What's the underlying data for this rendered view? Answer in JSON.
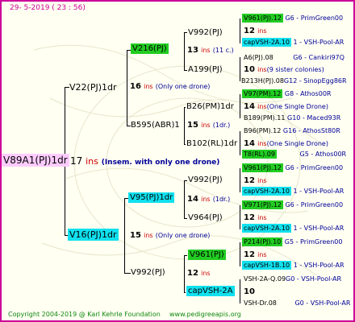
{
  "header": {
    "date": "29-  5-2019  ( 23 : 56)"
  },
  "root": {
    "name": "V89A1(PJ)1dr",
    "ins": "17",
    "ins_word": "ins",
    "note": "(Insem. with only one drone)"
  },
  "gen1": [
    {
      "name": "V22(PJ)1dr",
      "ins": "16",
      "ins_word": "ins",
      "note": "(Only one drone)"
    },
    {
      "name": "V16(PJ)1dr",
      "ins": "15",
      "ins_word": "ins",
      "note": "(Only one drone)"
    }
  ],
  "gen2": [
    {
      "name": "V216(PJ)",
      "ins": "13",
      "ins_word": "ins",
      "note": "(11 c.)"
    },
    {
      "name": "B595(ABR)1",
      "ins": "15",
      "ins_word": "ins",
      "note": "(1dr.)"
    },
    {
      "name": "V95(PJ)1dr",
      "ins": "14",
      "ins_word": "ins",
      "note": "(1dr.)"
    },
    {
      "name": "V992(PJ)",
      "ins": "12",
      "ins_word": "ins",
      "note": ""
    }
  ],
  "gen3": [
    {
      "name": "V992(PJ)"
    },
    {
      "name": "A199(PJ)"
    },
    {
      "name": "B26(PM)1dr"
    },
    {
      "name": "B102(RL)1dr"
    },
    {
      "name": "V992(PJ)"
    },
    {
      "name": "V964(PJ)"
    },
    {
      "name": "V961(PJ)"
    },
    {
      "name": "capVSH-2A"
    }
  ],
  "gen4": [
    {
      "top": "V961(PJ).12",
      "top_info": "G6 - PrimGreen00",
      "ins": "12",
      "ins_word": "ins",
      "note": "",
      "bottom": "capVSH-2A.10",
      "bottom_info": "1 - VSH-Pool-AR"
    },
    {
      "top": "A6(PJ).08",
      "top_info": "G6 - Cankiri97Q",
      "ins": "10",
      "ins_word": "ins",
      "note": "(9 sister colonies)",
      "bottom": "B213H(PJ).08",
      "bottom_info": "G12 - SinopEgg86R"
    },
    {
      "top": "V97(PM).12",
      "top_info": "G8 - Athos00R",
      "ins": "14",
      "ins_word": "ins",
      "note": "(One Single Drone)",
      "bottom": "B189(PM).11",
      "bottom_info": "G10 - Maced93R"
    },
    {
      "top": "B96(PM).12",
      "top_info": "G16 - AthosSt80R",
      "ins": "14",
      "ins_word": "ins",
      "note": "(One Single Drone)",
      "bottom": "T8(RL).09",
      "bottom_info": "G5 - Athos00R"
    },
    {
      "top": "V961(PJ).12",
      "top_info": "G6 - PrimGreen00",
      "ins": "12",
      "ins_word": "ins",
      "note": "",
      "bottom": "capVSH-2A.10",
      "bottom_info": "1 - VSH-Pool-AR"
    },
    {
      "top": "V971(PJ).12",
      "top_info": "G6 - PrimGreen00",
      "ins": "12",
      "ins_word": "ins",
      "note": "",
      "bottom": "capVSH-2A.10",
      "bottom_info": "1 - VSH-Pool-AR"
    },
    {
      "top": "P214(PJ).10",
      "top_info": "G5 - PrimGreen00",
      "ins": "12",
      "ins_word": "ins",
      "note": "",
      "bottom": "capVSH-1B.10",
      "bottom_info": "1 - VSH-Pool-AR"
    },
    {
      "top": "VSH-2A-Q.09",
      "top_info": "G0 - VSH-Pool-AR",
      "ins": "10",
      "ins_word": "",
      "note": "",
      "bottom": "VSH-Dr.08",
      "bottom_info": "G0 - VSH-Pool-AR"
    }
  ],
  "footer": {
    "copyright": "Copyright 2004-2019 @ Karl Kehrle Foundation",
    "url": "www.pedigreeapis.org"
  },
  "colors": {
    "border": "#cc0099",
    "background": "#fffff2",
    "green_box": "#22cc22",
    "cyan_box": "#11e0ee",
    "pink_box": "#ffccff",
    "ins_red": "#cc0000",
    "note_blue": "#000099"
  }
}
